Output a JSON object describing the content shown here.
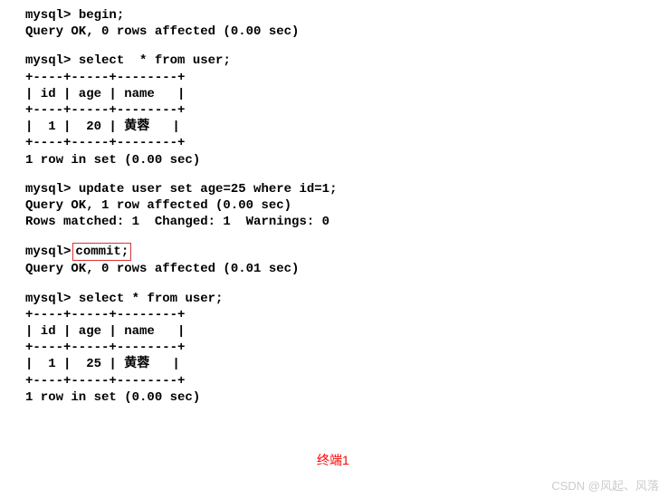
{
  "prompt": "mysql>",
  "cmd1": "begin;",
  "resp1": "Query OK, 0 rows affected (0.00 sec)",
  "cmd2": "select  * from user;",
  "table1": {
    "sep": "+----+-----+--------+",
    "header": "| id | age | name   |",
    "row": "|  1 |  20 | 黄蓉   |"
  },
  "resp2": "1 row in set (0.00 sec)",
  "cmd3": "update user set age=25 where id=1;",
  "resp3a": "Query OK, 1 row affected (0.00 sec)",
  "resp3b": "Rows matched: 1  Changed: 1  Warnings: 0",
  "cmd4": "commit;",
  "resp4": "Query OK, 0 rows affected (0.01 sec)",
  "cmd5": "select * from user;",
  "table2": {
    "sep": "+----+-----+--------+",
    "header": "| id | age | name   |",
    "row": "|  1 |  25 | 黄蓉   |"
  },
  "resp5": "1 row in set (0.00 sec)",
  "label": "终端1",
  "watermark": "CSDN @风起、风落"
}
